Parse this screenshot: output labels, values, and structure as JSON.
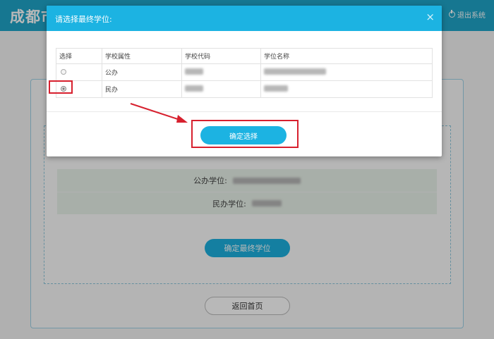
{
  "site": {
    "title": "成都市",
    "logout_label": "退出系统"
  },
  "main": {
    "public_label": "公办学位:",
    "private_label": "民办学位:",
    "confirm_final_label": "确定最终学位",
    "home_label": "返回首页"
  },
  "modal": {
    "title": "请选择最终学位:",
    "close_symbol": "×",
    "columns": [
      "选择",
      "学校属性",
      "学校代码",
      "学位名称"
    ],
    "rows": [
      {
        "type": "公办",
        "selected": false
      },
      {
        "type": "民办",
        "selected": true
      }
    ],
    "confirm_label": "确定选择"
  },
  "colors": {
    "accent": "#1cb3e2",
    "annotation": "#d7202e"
  },
  "icons": {
    "logout": "power-icon",
    "close": "close-icon",
    "annotation_arrow": "arrow-icon"
  }
}
